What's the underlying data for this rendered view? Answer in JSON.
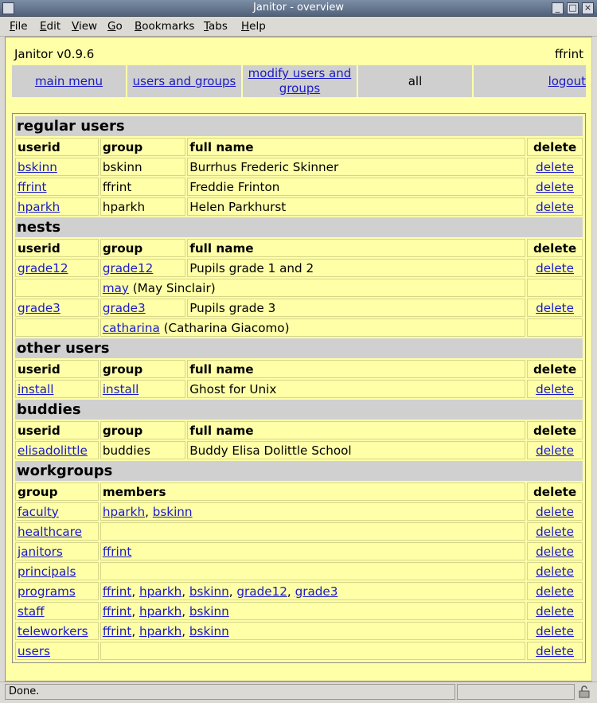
{
  "window": {
    "title": "Janitor - overview"
  },
  "menu": [
    "File",
    "Edit",
    "View",
    "Go",
    "Bookmarks",
    "Tabs",
    "Help"
  ],
  "app": {
    "name": "Janitor v0.9.6",
    "user": "ffrint"
  },
  "nav": {
    "main_menu": "main menu",
    "users_and_groups": "users and groups",
    "modify_line1": "modify users and",
    "modify_line2": "groups",
    "all": "all",
    "logout": "logout"
  },
  "headers": {
    "userid": "userid",
    "group": "group",
    "full_name": "full name",
    "delete": "delete",
    "members": "members"
  },
  "sections": {
    "regular": "regular users",
    "nests": "nests",
    "other": "other users",
    "buddies": "buddies",
    "workgroups": "workgroups"
  },
  "regular_users": [
    {
      "userid": "bskinn",
      "group": "bskinn",
      "full_name": "Burrhus Frederic Skinner",
      "delete": "delete"
    },
    {
      "userid": "ffrint",
      "group": "ffrint",
      "full_name": "Freddie Frinton",
      "delete": "delete"
    },
    {
      "userid": "hparkh",
      "group": "hparkh",
      "full_name": "Helen Parkhurst",
      "delete": "delete"
    }
  ],
  "nests": [
    {
      "userid": "grade12",
      "group": "grade12",
      "full_name": "Pupils grade 1 and 2",
      "delete": "delete",
      "member": "may",
      "member_name": " (May Sinclair)"
    },
    {
      "userid": "grade3",
      "group": "grade3",
      "full_name": "Pupils grade 3",
      "delete": "delete",
      "member": "catharina",
      "member_name": " (Catharina Giacomo)"
    }
  ],
  "other_users": [
    {
      "userid": "install",
      "group": "install",
      "full_name": "Ghost for Unix",
      "delete": "delete"
    }
  ],
  "buddies": [
    {
      "userid": "elisadolittle",
      "group": "buddies",
      "full_name": "Buddy Elisa Dolittle School",
      "delete": "delete"
    }
  ],
  "workgroups": [
    {
      "group": "faculty",
      "members": [
        "hparkh",
        "bskinn"
      ],
      "delete": "delete"
    },
    {
      "group": "healthcare",
      "members": [],
      "delete": "delete"
    },
    {
      "group": "janitors",
      "members": [
        "ffrint"
      ],
      "delete": "delete"
    },
    {
      "group": "principals",
      "members": [],
      "delete": "delete"
    },
    {
      "group": "programs",
      "members": [
        "ffrint",
        "hparkh",
        "bskinn",
        "grade12",
        "grade3"
      ],
      "delete": "delete"
    },
    {
      "group": "staff",
      "members": [
        "ffrint",
        "hparkh",
        "bskinn"
      ],
      "delete": "delete"
    },
    {
      "group": "teleworkers",
      "members": [
        "ffrint",
        "hparkh",
        "bskinn"
      ],
      "delete": "delete"
    },
    {
      "group": "users",
      "members": [],
      "delete": "delete"
    }
  ],
  "member_separator": ", ",
  "status": {
    "text": "Done."
  },
  "colors": {
    "page_bg": "#ffffa8",
    "section_bg": "#d0d0d0",
    "link": "#1a1ac8"
  }
}
